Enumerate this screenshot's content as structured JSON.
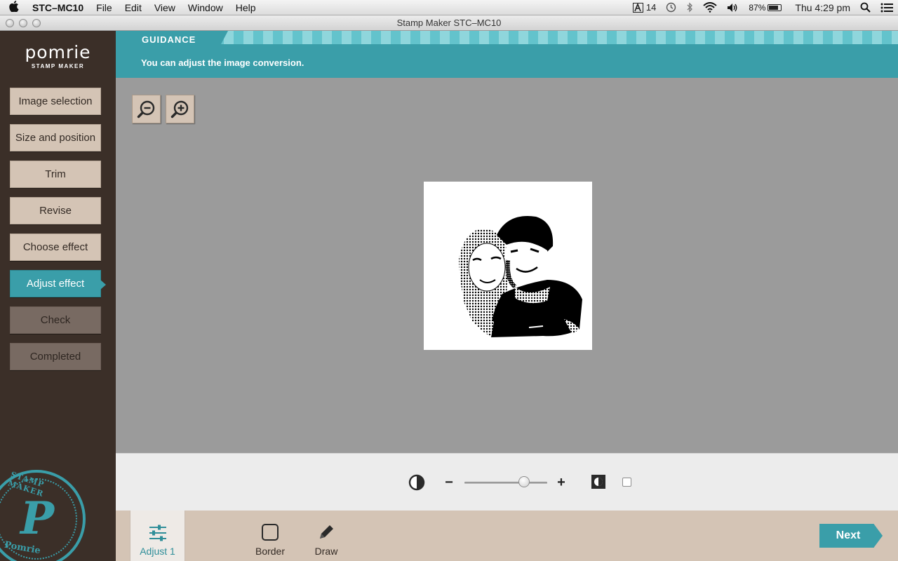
{
  "menubar": {
    "app_name": "STC–MC10",
    "items": [
      "File",
      "Edit",
      "View",
      "Window",
      "Help"
    ],
    "status": {
      "adobe_count": "14",
      "battery": "87%",
      "clock": "Thu 4:29 pm"
    }
  },
  "window": {
    "title": "Stamp Maker STC–MC10"
  },
  "logo": {
    "name": "pomrie",
    "subtitle": "STAMP MAKER"
  },
  "steps": [
    {
      "label": "Image selection",
      "state": "normal"
    },
    {
      "label": "Size and position",
      "state": "normal"
    },
    {
      "label": "Trim",
      "state": "normal"
    },
    {
      "label": "Revise",
      "state": "normal"
    },
    {
      "label": "Choose effect",
      "state": "normal"
    },
    {
      "label": "Adjust effect",
      "state": "active"
    },
    {
      "label": "Check",
      "state": "disabled"
    },
    {
      "label": "Completed",
      "state": "disabled"
    }
  ],
  "seal": {
    "top_text": "STAMP MAKER",
    "letter": "P",
    "bottom_text": "Pomrie"
  },
  "guidance": {
    "tab": "GUIDANCE",
    "message": "You can adjust the image conversion."
  },
  "zoom": {
    "out_icon": "zoom-out-icon",
    "in_icon": "zoom-in-icon"
  },
  "adjust": {
    "contrast_icon": "contrast-icon",
    "minus": "−",
    "plus": "+",
    "slider_value": 0.72,
    "invert_icon": "invert-icon",
    "checkbox_checked": false
  },
  "toolbar": {
    "tools": [
      {
        "label": "Adjust 1",
        "icon": "sliders-icon",
        "active": true
      },
      {
        "label": "Border",
        "icon": "square-icon",
        "active": false
      },
      {
        "label": "Draw",
        "icon": "pencil-icon",
        "active": false
      }
    ],
    "next_label": "Next"
  },
  "colors": {
    "accent": "#3a9ea9",
    "sidebar_bg": "#3b2f28",
    "step_bg": "#d4c4b5",
    "step_disabled_bg": "#786a62",
    "canvas_bg": "#9b9b9b"
  }
}
